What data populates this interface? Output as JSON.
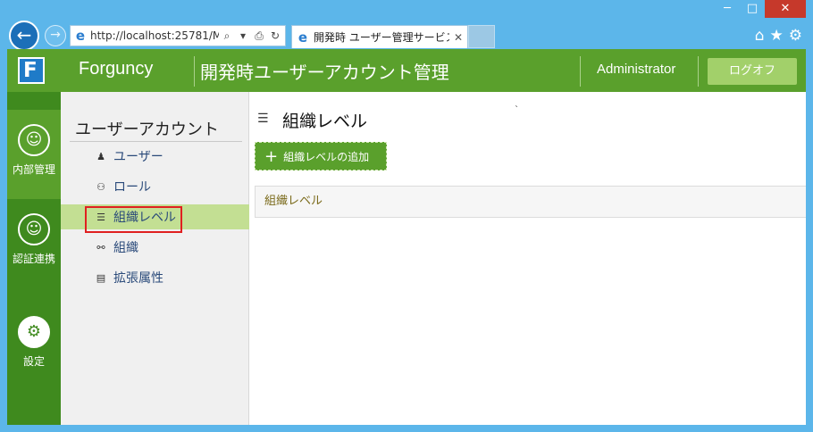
{
  "window": {
    "minimize": "─",
    "maximize": "□",
    "close": "✕"
  },
  "browser": {
    "url": "http://localhost:25781/M",
    "tab_title": "開発時 ユーザー管理サービス",
    "tab_close": "✕"
  },
  "header": {
    "brand": "Forguncy",
    "title": "開発時ユーザーアカウント管理",
    "user": "Administrator",
    "logout_label": "ログオフ"
  },
  "rail": {
    "items": [
      {
        "label": "内部管理",
        "icon": "internal-management-icon"
      },
      {
        "label": "認証連携",
        "icon": "authentication-link-icon"
      },
      {
        "label": "設定",
        "icon": "gear-icon"
      }
    ]
  },
  "sidebar": {
    "heading": "ユーザーアカウント",
    "items": [
      {
        "label": "ユーザー",
        "icon": "person-icon"
      },
      {
        "label": "ロール",
        "icon": "group-icon"
      },
      {
        "label": "組織レベル",
        "icon": "level-list-icon"
      },
      {
        "label": "組織",
        "icon": "org-tree-icon"
      },
      {
        "label": "拡張属性",
        "icon": "extended-attributes-icon"
      }
    ],
    "active_index": 2
  },
  "main": {
    "page_title": "組織レベル",
    "add_button_label": "組織レベルの追加",
    "grid_column": "組織レベル"
  },
  "colors": {
    "header_green": "#5aa02c",
    "rail_green": "#3f8a1e",
    "active_item": "#c3df93",
    "logout_button": "#a2d06a",
    "highlight_border": "#e02020"
  }
}
